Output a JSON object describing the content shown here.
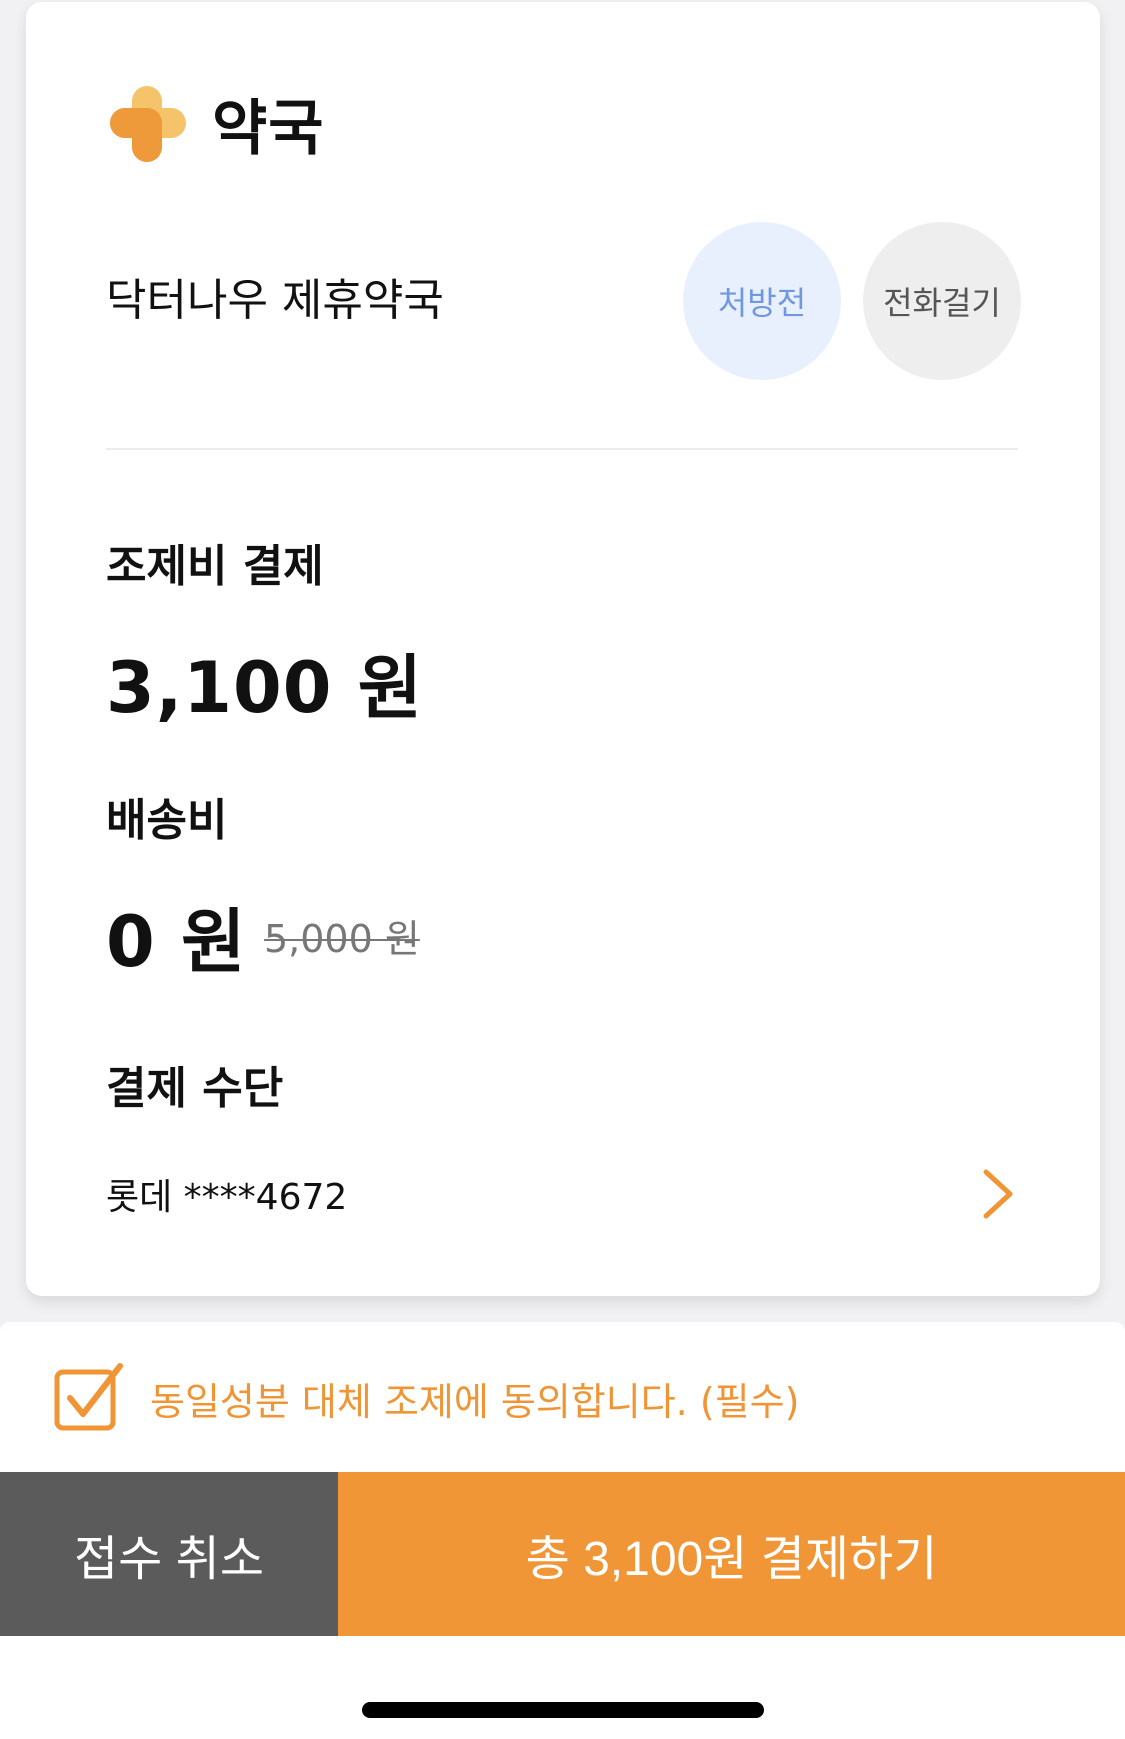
{
  "card": {
    "title": "약국",
    "pharmacy_name": "닥터나우 제휴약국",
    "status_button": "처방전",
    "call_button": "전화걸기",
    "dispensing_fee": {
      "label": "조제비 결제",
      "amount": "3,100 원"
    },
    "delivery_fee": {
      "label": "배송비",
      "amount": "0 원",
      "original_amount": "5,000 원"
    },
    "payment_method": {
      "label": "결제 수단",
      "card": "롯데 ****4672"
    }
  },
  "agreement": {
    "text": "동일성분 대체 조제에 동의합니다. (필수)",
    "checked": true
  },
  "buttons": {
    "cancel": "접수 취소",
    "pay": "총 3,100원 결제하기"
  },
  "colors": {
    "accent": "#f09637",
    "cancel_bg": "#5b5b5b",
    "status_bg": "#e9f0fd",
    "status_text": "#6f98e0"
  },
  "icons": [
    "pharmacy-cross-icon",
    "chevron-right-icon",
    "checkbox-checked-icon"
  ]
}
